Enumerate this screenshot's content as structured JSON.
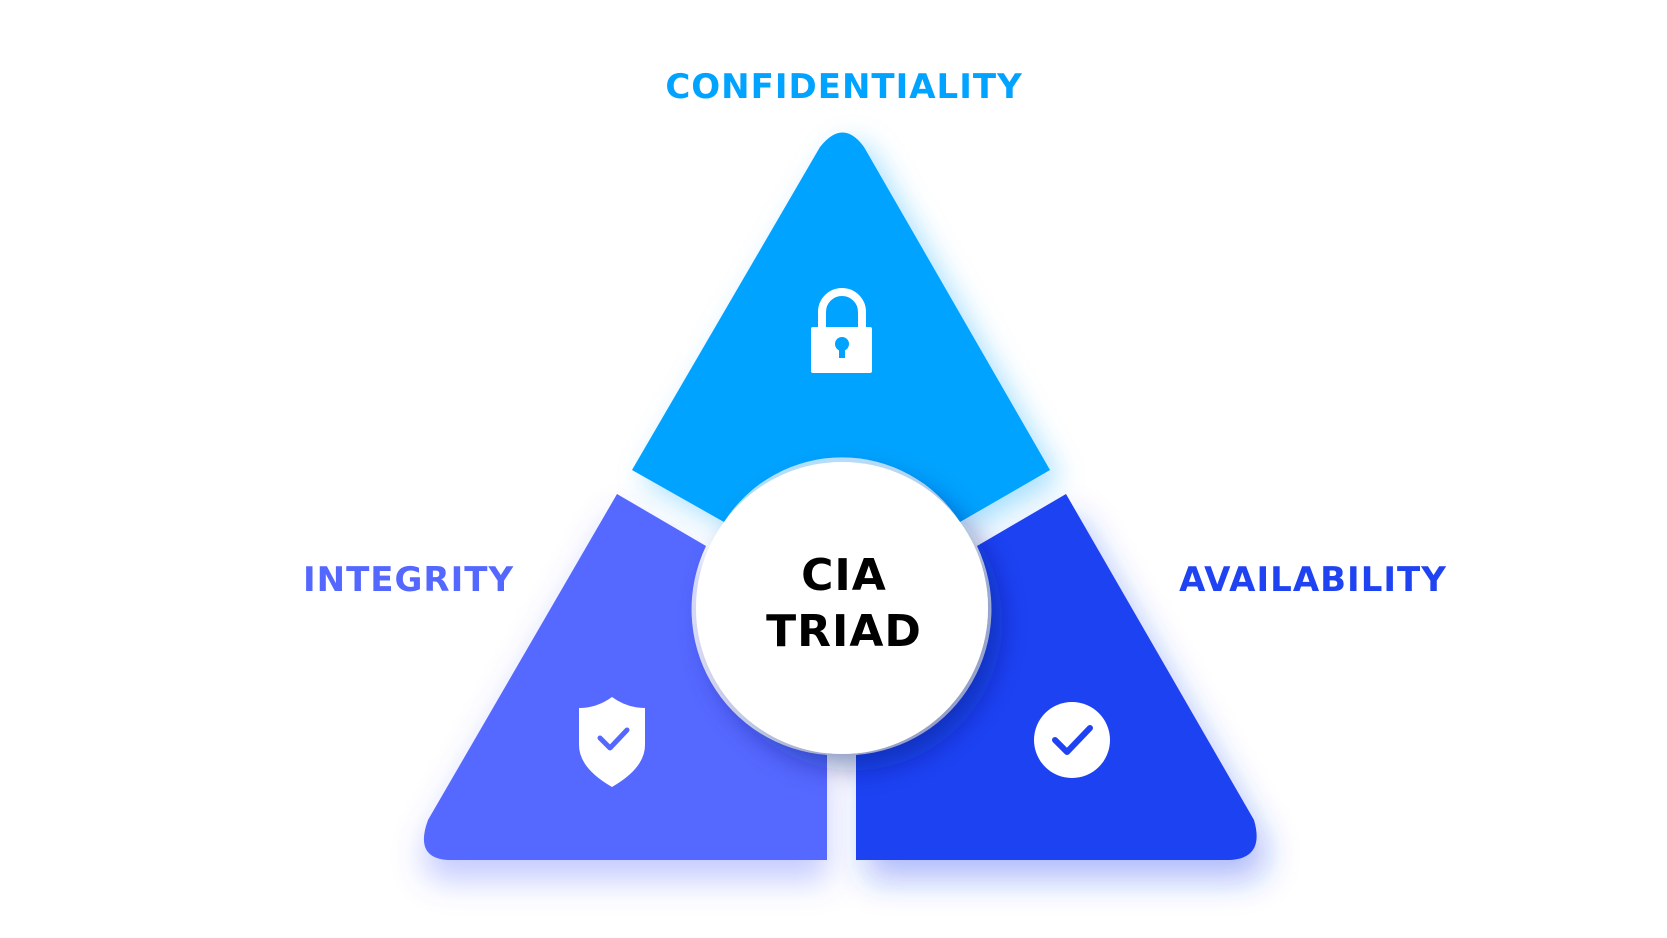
{
  "diagram": {
    "center": {
      "line1": "CIA",
      "line2": "TRIAD"
    },
    "segments": [
      {
        "key": "confidentiality",
        "label": "CONFIDENTIALITY",
        "icon": "lock-icon",
        "color": "#00A3FF"
      },
      {
        "key": "integrity",
        "label": "INTEGRITY",
        "icon": "shield-check-icon",
        "color": "#5468FF"
      },
      {
        "key": "availability",
        "label": "AVAILABILITY",
        "icon": "check-circle-icon",
        "color": "#1F43F2"
      }
    ]
  }
}
